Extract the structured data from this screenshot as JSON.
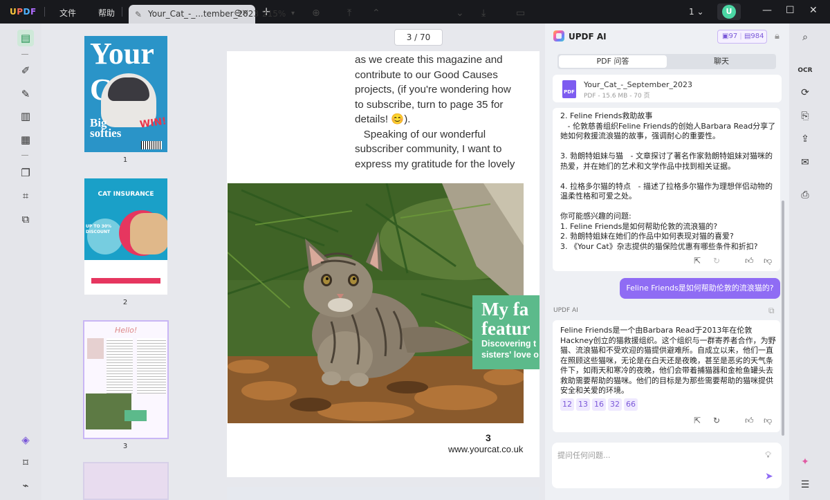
{
  "titlebar": {
    "logo": [
      "U",
      "P",
      "D",
      "F"
    ],
    "menu": [
      "文件",
      "帮助"
    ],
    "tab_title": "Your_Cat_-_...tember_2023",
    "page_indicator": "1",
    "avatar_initial": "U"
  },
  "thumbnails": {
    "pages": [
      "1",
      "2",
      "3"
    ],
    "cover": {
      "title": "Your Cat",
      "subtitle": "Big softies",
      "win": "WIN!"
    },
    "page2": {
      "header": "CAT INSURANCE",
      "discount": "UP TO 30% DISCOUNT"
    },
    "page3": {
      "hello": "Hello!"
    }
  },
  "pdf_toolbar": {
    "zoom": "215%",
    "current_page": "3",
    "total_pages": "70",
    "page_sep": "/"
  },
  "page": {
    "text_lines": [
      "as we create this magazine and",
      "contribute to our Good Causes",
      "projects, (if you're wondering how",
      "to subscribe, turn to page 35 for",
      "details! 😊).",
      "   Speaking of our wonderful",
      "subscriber community, I want to",
      "express my gratitude for the lovely"
    ],
    "banner_title_1": "My fa",
    "banner_title_2": "featur",
    "banner_sub_1": "Discovering t",
    "banner_sub_2": "sisters' love o",
    "page_number": "3",
    "url": "www.yourcat.co.uk"
  },
  "ai": {
    "title": "UPDF AI",
    "quota_1": "97",
    "quota_2": "984",
    "tab_pdf": "PDF 问答",
    "tab_chat": "聊天",
    "file_name": "Your_Cat_-_September_2023",
    "file_meta": "PDF - 15.6 MB - 70 页",
    "file_badge": "PDF",
    "message1_lines": [
      "2. Feline Friends救助故事",
      "   - 伦敦慈善组织Feline Friends的创始人Barbara Read分享了",
      "她如何救援流浪猫的故事，强调耐心的重要性。",
      "",
      "3. 勃朗特姐妹与猫   - 文章探讨了著名作家勃朗特姐妹对猫咪的",
      "热爱，并在她们的艺术和文学作品中找到相关证据。",
      "",
      "4. 拉格多尔猫的特点   - 描述了拉格多尔猫作为理想伴侣动物的",
      "温柔性格和可爱之处。",
      "",
      "你可能感兴趣的问题:",
      "1. Feline Friends是如何帮助伦敦的流浪猫的?",
      "2. 勃朗特姐妹在她们的作品中如何表现对猫的喜爱?",
      "3. 《Your Cat》杂志提供的猫保险优惠有哪些条件和折扣?"
    ],
    "user_question": "Feline Friends是如何帮助伦敦的流浪猫的?",
    "ai_label": "UPDF AI",
    "message2_lines": [
      "Feline Friends是一个由Barbara Read于2013年在伦敦",
      "Hackney创立的猫救援组织。这个组织与一群寄养者合作，为野",
      "猫、流浪猫和不受欢迎的猫提供避难所。自成立以来，他们一直",
      "在照顾这些猫咪，无论是在白天还是夜晚，甚至是恶劣的天气条",
      "件下，如雨天和寒冷的夜晚，他们会带着捕猫器和金枪鱼罐头去",
      "救助需要帮助的猫咪。他们的目标是为那些需要帮助的猫咪提供",
      "安全和关爱的环境。"
    ],
    "references": [
      "12",
      "13",
      "16",
      "32",
      "66"
    ],
    "input_placeholder": "提问任何问题..."
  }
}
